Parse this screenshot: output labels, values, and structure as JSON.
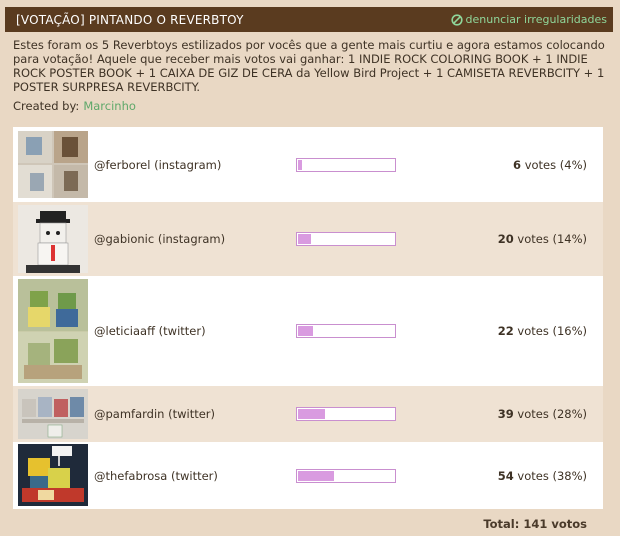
{
  "header": {
    "title": "[VOTAÇÃO] PINTANDO O REVERBTOY",
    "report_label": "denunciar irregularidades"
  },
  "description": "Estes foram os 5 Reverbtoys estilizados por vocês que a gente mais curtiu e agora estamos colocando para votação! Aquele que receber mais votos vai ganhar: 1 INDIE ROCK COLORING BOOK + 1 INDIE ROCK POSTER BOOK + 1 CAIXA DE GIZ DE CERA da Yellow Bird Project + 1 CAMISETA REVERBCITY + 1 POSTER SURPRESA REVERBCITY.",
  "created": {
    "label": "Created by:",
    "author": "Marcinho"
  },
  "options": [
    {
      "name": "@ferborel (instagram)",
      "votes": "6",
      "votes_suffix": " votes (4%)",
      "percent": 4
    },
    {
      "name": "@gabionic (instagram)",
      "votes": "20",
      "votes_suffix": " votes (14%)",
      "percent": 14
    },
    {
      "name": "@leticiaaff (twitter)",
      "votes": "22",
      "votes_suffix": " votes (16%)",
      "percent": 16
    },
    {
      "name": "@pamfardin (twitter)",
      "votes": "39",
      "votes_suffix": " votes (28%)",
      "percent": 28
    },
    {
      "name": "@thefabrosa (twitter)",
      "votes": "54",
      "votes_suffix": " votes (38%)",
      "percent": 38
    }
  ],
  "total": "Total: 141 votos",
  "colors": {
    "header_bg": "#5a3b1f",
    "bar_fill": "#d99be0",
    "bar_border": "#c98fcf",
    "author_link": "#5fa86a"
  }
}
